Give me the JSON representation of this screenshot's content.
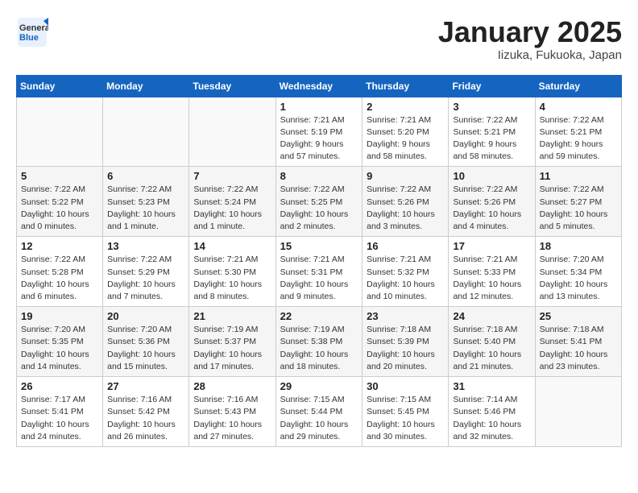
{
  "header": {
    "logo_general": "General",
    "logo_blue": "Blue",
    "month_title": "January 2025",
    "location": "Iizuka, Fukuoka, Japan"
  },
  "weekdays": [
    "Sunday",
    "Monday",
    "Tuesday",
    "Wednesday",
    "Thursday",
    "Friday",
    "Saturday"
  ],
  "weeks": [
    [
      {
        "day": "",
        "info": ""
      },
      {
        "day": "",
        "info": ""
      },
      {
        "day": "",
        "info": ""
      },
      {
        "day": "1",
        "info": "Sunrise: 7:21 AM\nSunset: 5:19 PM\nDaylight: 9 hours\nand 57 minutes."
      },
      {
        "day": "2",
        "info": "Sunrise: 7:21 AM\nSunset: 5:20 PM\nDaylight: 9 hours\nand 58 minutes."
      },
      {
        "day": "3",
        "info": "Sunrise: 7:22 AM\nSunset: 5:21 PM\nDaylight: 9 hours\nand 58 minutes."
      },
      {
        "day": "4",
        "info": "Sunrise: 7:22 AM\nSunset: 5:21 PM\nDaylight: 9 hours\nand 59 minutes."
      }
    ],
    [
      {
        "day": "5",
        "info": "Sunrise: 7:22 AM\nSunset: 5:22 PM\nDaylight: 10 hours\nand 0 minutes."
      },
      {
        "day": "6",
        "info": "Sunrise: 7:22 AM\nSunset: 5:23 PM\nDaylight: 10 hours\nand 1 minute."
      },
      {
        "day": "7",
        "info": "Sunrise: 7:22 AM\nSunset: 5:24 PM\nDaylight: 10 hours\nand 1 minute."
      },
      {
        "day": "8",
        "info": "Sunrise: 7:22 AM\nSunset: 5:25 PM\nDaylight: 10 hours\nand 2 minutes."
      },
      {
        "day": "9",
        "info": "Sunrise: 7:22 AM\nSunset: 5:26 PM\nDaylight: 10 hours\nand 3 minutes."
      },
      {
        "day": "10",
        "info": "Sunrise: 7:22 AM\nSunset: 5:26 PM\nDaylight: 10 hours\nand 4 minutes."
      },
      {
        "day": "11",
        "info": "Sunrise: 7:22 AM\nSunset: 5:27 PM\nDaylight: 10 hours\nand 5 minutes."
      }
    ],
    [
      {
        "day": "12",
        "info": "Sunrise: 7:22 AM\nSunset: 5:28 PM\nDaylight: 10 hours\nand 6 minutes."
      },
      {
        "day": "13",
        "info": "Sunrise: 7:22 AM\nSunset: 5:29 PM\nDaylight: 10 hours\nand 7 minutes."
      },
      {
        "day": "14",
        "info": "Sunrise: 7:21 AM\nSunset: 5:30 PM\nDaylight: 10 hours\nand 8 minutes."
      },
      {
        "day": "15",
        "info": "Sunrise: 7:21 AM\nSunset: 5:31 PM\nDaylight: 10 hours\nand 9 minutes."
      },
      {
        "day": "16",
        "info": "Sunrise: 7:21 AM\nSunset: 5:32 PM\nDaylight: 10 hours\nand 10 minutes."
      },
      {
        "day": "17",
        "info": "Sunrise: 7:21 AM\nSunset: 5:33 PM\nDaylight: 10 hours\nand 12 minutes."
      },
      {
        "day": "18",
        "info": "Sunrise: 7:20 AM\nSunset: 5:34 PM\nDaylight: 10 hours\nand 13 minutes."
      }
    ],
    [
      {
        "day": "19",
        "info": "Sunrise: 7:20 AM\nSunset: 5:35 PM\nDaylight: 10 hours\nand 14 minutes."
      },
      {
        "day": "20",
        "info": "Sunrise: 7:20 AM\nSunset: 5:36 PM\nDaylight: 10 hours\nand 15 minutes."
      },
      {
        "day": "21",
        "info": "Sunrise: 7:19 AM\nSunset: 5:37 PM\nDaylight: 10 hours\nand 17 minutes."
      },
      {
        "day": "22",
        "info": "Sunrise: 7:19 AM\nSunset: 5:38 PM\nDaylight: 10 hours\nand 18 minutes."
      },
      {
        "day": "23",
        "info": "Sunrise: 7:18 AM\nSunset: 5:39 PM\nDaylight: 10 hours\nand 20 minutes."
      },
      {
        "day": "24",
        "info": "Sunrise: 7:18 AM\nSunset: 5:40 PM\nDaylight: 10 hours\nand 21 minutes."
      },
      {
        "day": "25",
        "info": "Sunrise: 7:18 AM\nSunset: 5:41 PM\nDaylight: 10 hours\nand 23 minutes."
      }
    ],
    [
      {
        "day": "26",
        "info": "Sunrise: 7:17 AM\nSunset: 5:41 PM\nDaylight: 10 hours\nand 24 minutes."
      },
      {
        "day": "27",
        "info": "Sunrise: 7:16 AM\nSunset: 5:42 PM\nDaylight: 10 hours\nand 26 minutes."
      },
      {
        "day": "28",
        "info": "Sunrise: 7:16 AM\nSunset: 5:43 PM\nDaylight: 10 hours\nand 27 minutes."
      },
      {
        "day": "29",
        "info": "Sunrise: 7:15 AM\nSunset: 5:44 PM\nDaylight: 10 hours\nand 29 minutes."
      },
      {
        "day": "30",
        "info": "Sunrise: 7:15 AM\nSunset: 5:45 PM\nDaylight: 10 hours\nand 30 minutes."
      },
      {
        "day": "31",
        "info": "Sunrise: 7:14 AM\nSunset: 5:46 PM\nDaylight: 10 hours\nand 32 minutes."
      },
      {
        "day": "",
        "info": ""
      }
    ]
  ]
}
